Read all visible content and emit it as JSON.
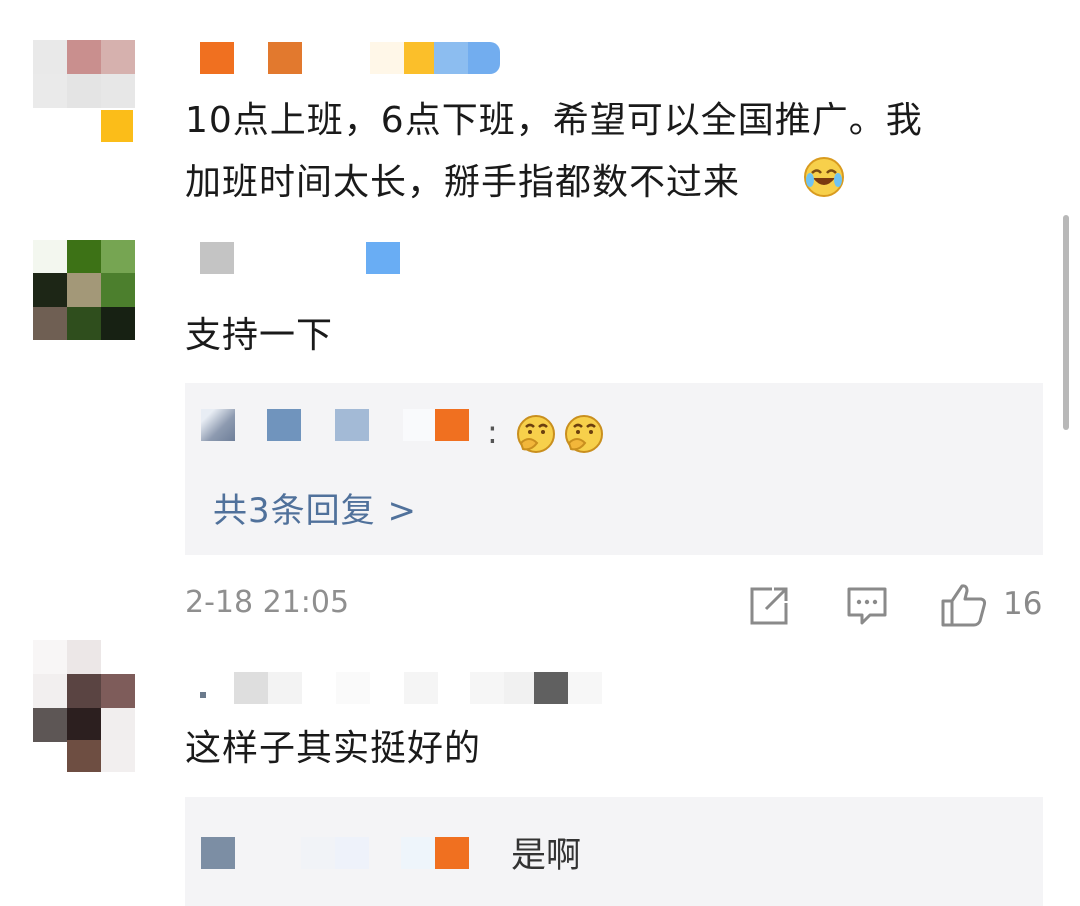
{
  "comments": [
    {
      "text": "10点上班，6点下班，希望可以全国推广。我\n加班时间太长，掰手指都数不过来",
      "emoji": "laughing-crying-emoji"
    },
    {
      "text": "支持一下",
      "reply_colon": ":",
      "reply_emojis": [
        "thinking-emoji",
        "thinking-emoji"
      ],
      "more_replies": "共3条回复 >",
      "time": "2-18 21:05",
      "like_count": "16"
    },
    {
      "text": "这样子其实挺好的",
      "reply_text": "是啊"
    }
  ],
  "icons": {
    "share": "share-icon",
    "comment": "comment-icon",
    "like": "thumbs-up-icon"
  },
  "colors": {
    "link": "#50719b",
    "meta": "#8f8f8f",
    "reply_bg": "#f4f4f6"
  }
}
